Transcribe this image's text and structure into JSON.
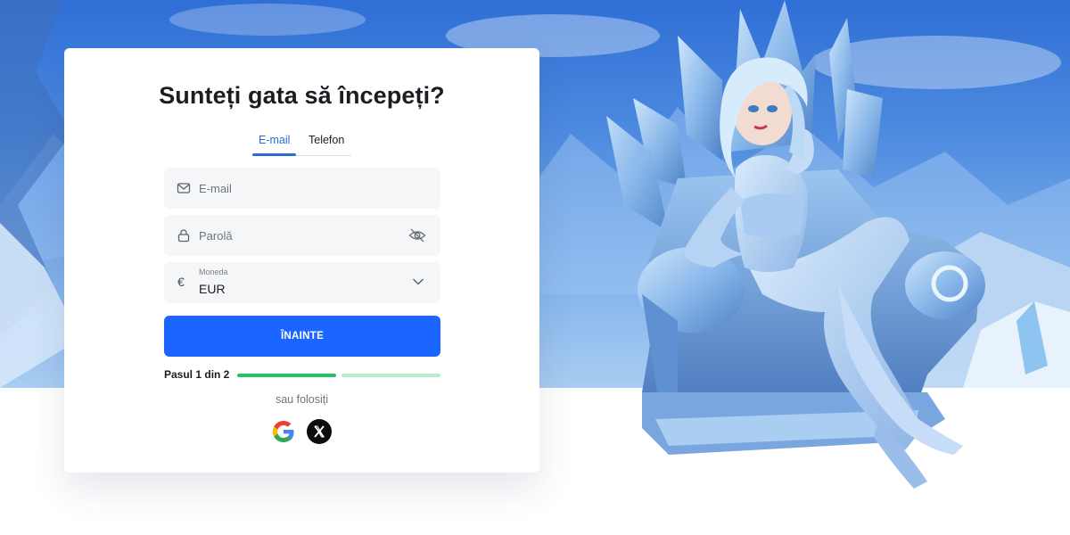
{
  "form": {
    "title": "Sunteți gata să începeți?",
    "tabs": [
      {
        "label": "E-mail",
        "active": true
      },
      {
        "label": "Telefon",
        "active": false
      }
    ],
    "email": {
      "placeholder": "E-mail",
      "icon": "mail-icon"
    },
    "password": {
      "placeholder": "Parolă",
      "icon": "lock-icon",
      "toggle_icon": "eye-off-icon"
    },
    "currency": {
      "label": "Moneda",
      "value": "EUR",
      "icon": "euro-icon",
      "chevron_icon": "chevron-down-icon"
    },
    "submit_label": "ÎNAINTE",
    "steps": {
      "label": "Pasul 1 din 2",
      "current": 1,
      "total": 2
    },
    "alt_label": "sau folosiți",
    "social": [
      {
        "name": "Google",
        "icon": "google-icon"
      },
      {
        "name": "X",
        "icon": "x-icon"
      }
    ]
  },
  "colors": {
    "primary": "#1a66ff",
    "tab_active": "#2a6bd8",
    "progress_done": "#22c262",
    "progress_todo": "#b9ebcd"
  }
}
